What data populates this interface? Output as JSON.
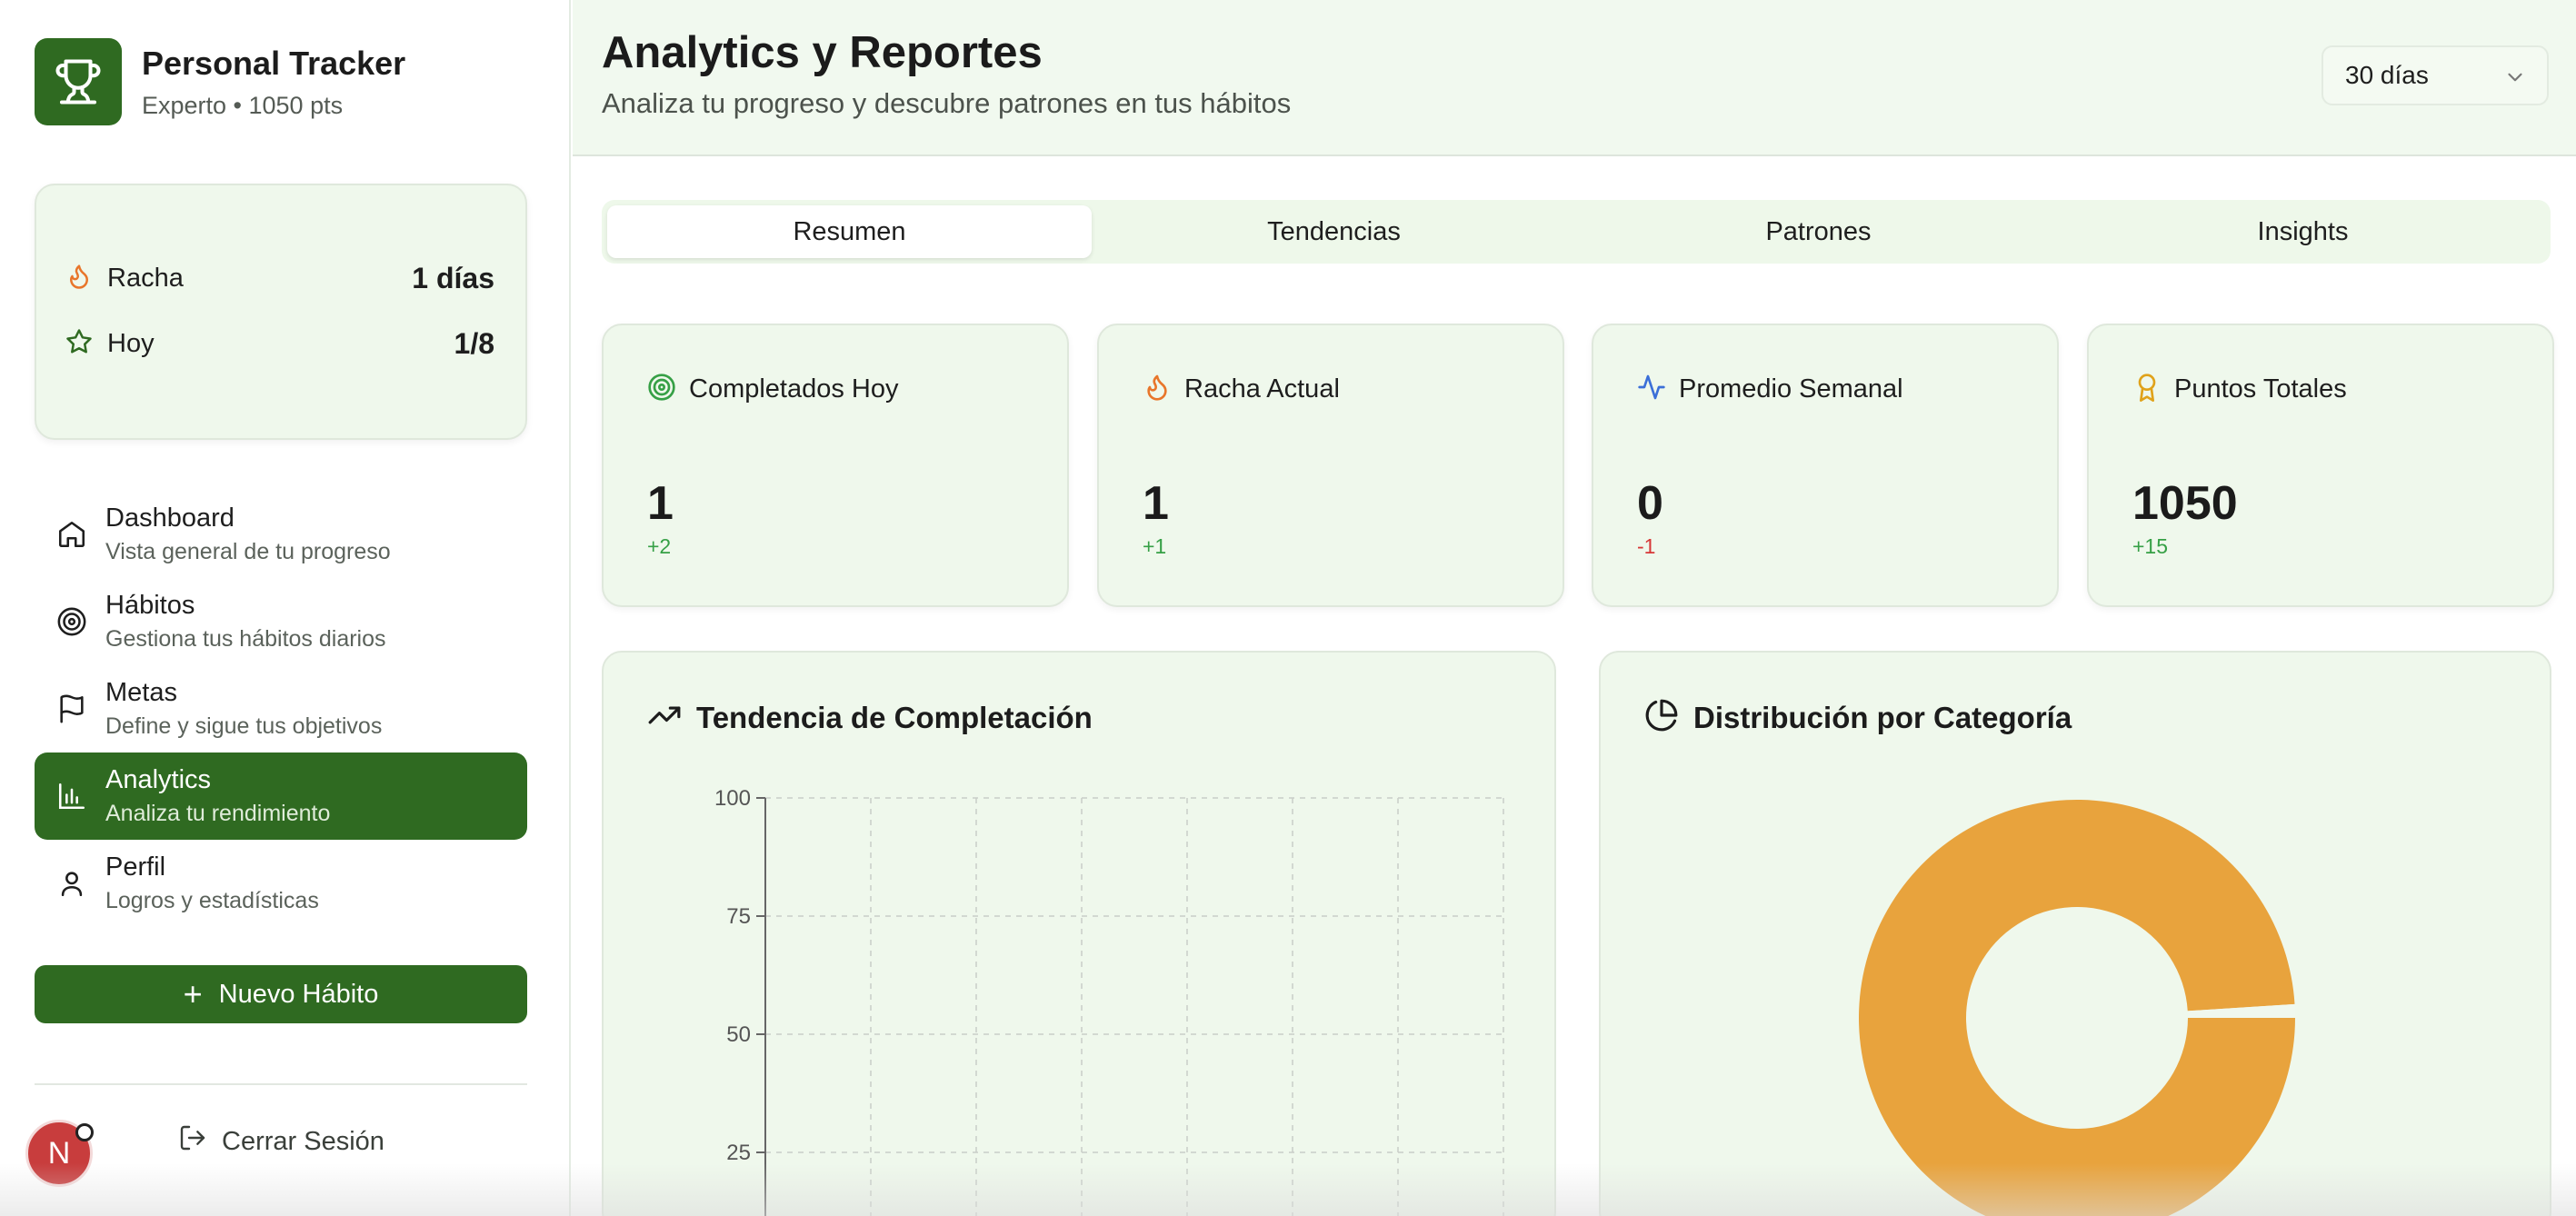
{
  "brand": {
    "title": "Personal Tracker",
    "subtitle": "Experto • 1050 pts",
    "icon": "trophy-icon"
  },
  "stats": [
    {
      "label": "Racha",
      "value": "1 días",
      "icon": "flame-icon"
    },
    {
      "label": "Hoy",
      "value": "1/8",
      "icon": "star-icon"
    }
  ],
  "nav": [
    {
      "title": "Dashboard",
      "subtitle": "Vista general de tu progreso",
      "icon": "home-icon",
      "active": false
    },
    {
      "title": "Hábitos",
      "subtitle": "Gestiona tus hábitos diarios",
      "icon": "target-icon",
      "active": false
    },
    {
      "title": "Metas",
      "subtitle": "Define y sigue tus objetivos",
      "icon": "flag-icon",
      "active": false
    },
    {
      "title": "Analytics",
      "subtitle": "Analiza tu rendimiento",
      "icon": "bar-chart-icon",
      "active": true
    },
    {
      "title": "Perfil",
      "subtitle": "Logros y estadísticas",
      "icon": "user-icon",
      "active": false
    }
  ],
  "new_habit_label": "Nuevo Hábito",
  "logout_label": "Cerrar Sesión",
  "avatar_letter": "N",
  "header": {
    "title": "Analytics y Reportes",
    "subtitle": "Analiza tu progreso y descubre patrones en tus hábitos",
    "range": "30 días"
  },
  "tabs": [
    {
      "label": "Resumen",
      "active": true
    },
    {
      "label": "Tendencias",
      "active": false
    },
    {
      "label": "Patrones",
      "active": false
    },
    {
      "label": "Insights",
      "active": false
    }
  ],
  "kpis": [
    {
      "label": "Completados Hoy",
      "value": "1",
      "delta": "+2",
      "trend": "pos",
      "icon": "target-icon",
      "color": "#36a046"
    },
    {
      "label": "Racha Actual",
      "value": "1",
      "delta": "+1",
      "trend": "pos",
      "icon": "flame-icon",
      "color": "#e8762b"
    },
    {
      "label": "Promedio Semanal",
      "value": "0",
      "delta": "-1",
      "trend": "neg",
      "icon": "activity-icon",
      "color": "#3b6fd8"
    },
    {
      "label": "Puntos Totales",
      "value": "1050",
      "delta": "+15",
      "trend": "pos",
      "icon": "award-icon",
      "color": "#e0a21a"
    }
  ],
  "panels": {
    "trend_title": "Tendencia de Completación",
    "dist_title": "Distribución por Categoría"
  },
  "chart_data": [
    {
      "type": "line",
      "title": "Tendencia de Completación",
      "ylim": [
        0,
        100
      ],
      "yticks": [
        "100",
        "75",
        "50",
        "25"
      ],
      "grid": true,
      "series": []
    },
    {
      "type": "pie",
      "title": "Distribución por Categoría",
      "donut": true,
      "slices": [
        {
          "value": 99,
          "color": "#e8a33d"
        },
        {
          "value": 1,
          "color": "#f0f8ee"
        }
      ]
    }
  ]
}
